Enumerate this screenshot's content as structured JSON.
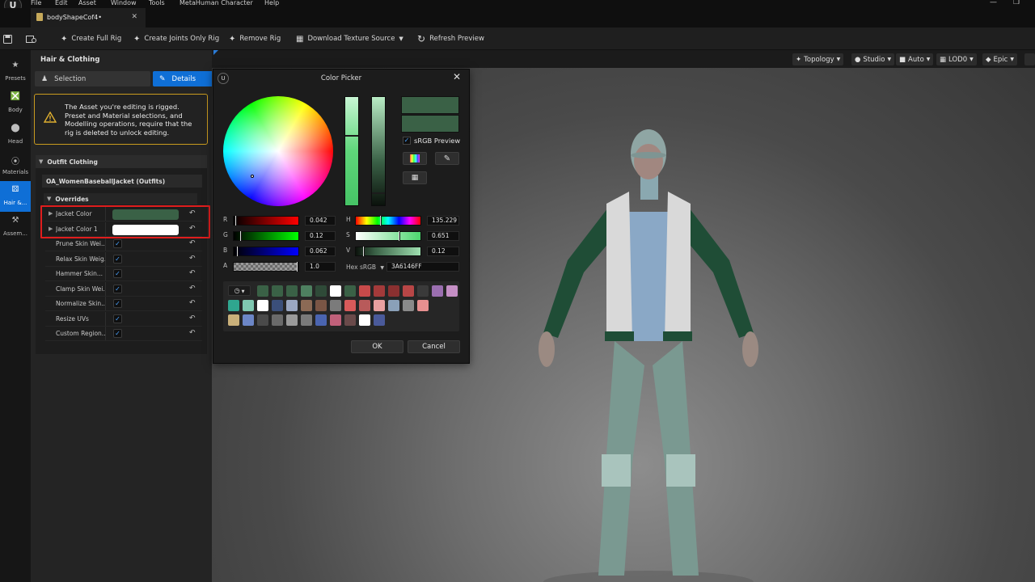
{
  "menu": [
    "File",
    "Edit",
    "Asset",
    "Window",
    "Tools",
    "MetaHuman Character",
    "Help"
  ],
  "document_tab": {
    "title": "bodyShapeCof4•"
  },
  "toolbar": {
    "create_full_rig": "Create Full Rig",
    "create_joints_only_rig": "Create Joints Only Rig",
    "remove_rig": "Remove Rig",
    "download_texture_source": "Download Texture Source",
    "refresh_preview": "Refresh Preview"
  },
  "nav": [
    {
      "label": "Presets",
      "icon": "star-icon"
    },
    {
      "label": "Body",
      "icon": "body-icon"
    },
    {
      "label": "Head",
      "icon": "head-icon"
    },
    {
      "label": "Materials",
      "icon": "materials-icon"
    },
    {
      "label": "Hair &...",
      "icon": "hair-icon",
      "active": true
    },
    {
      "label": "Assem...",
      "icon": "hammer-icon"
    }
  ],
  "panel": {
    "title": "Hair & Clothing",
    "tab_selection": "Selection",
    "tab_details": "Details",
    "warning": "The Asset you're editing is rigged. Preset and Material selections, and Modelling operations, require that the rig is deleted to unlock editing.",
    "section_outfit": "Outfit Clothing",
    "outfit_item": "OA_WomenBaseballJacket (Outfits)",
    "overrides": "Overrides",
    "color_rows": [
      {
        "label": "Jacket Color",
        "color": "#3a6146"
      },
      {
        "label": "Jacket Color 1",
        "color": "#ffffff"
      }
    ],
    "check_rows": [
      {
        "label": "Prune Skin Wei...",
        "checked": true
      },
      {
        "label": "Relax Skin Weig...",
        "checked": true
      },
      {
        "label": "Hammer Skin...",
        "checked": true
      },
      {
        "label": "Clamp Skin Wei...",
        "checked": true
      },
      {
        "label": "Normalize Skin...",
        "checked": true
      },
      {
        "label": "Resize UVs",
        "checked": true
      },
      {
        "label": "Custom Region...",
        "checked": true
      }
    ]
  },
  "viewport": {
    "topology": "Topology",
    "studio": "Studio",
    "auto": "Auto",
    "lod": "LOD0",
    "quality": "Epic"
  },
  "color_picker": {
    "title": "Color Picker",
    "srgb_preview": "sRGB Preview",
    "srgb_checked": true,
    "current_color": "#3a6146",
    "r": {
      "label": "R",
      "value": "0.042"
    },
    "g": {
      "label": "G",
      "value": "0.12"
    },
    "b": {
      "label": "B",
      "value": "0.062"
    },
    "a": {
      "label": "A",
      "value": "1.0"
    },
    "h": {
      "label": "H",
      "value": "135.229"
    },
    "s": {
      "label": "S",
      "value": "0.651"
    },
    "v": {
      "label": "V",
      "value": "0.12"
    },
    "hex_label": "Hex sRGB",
    "hex_value": "3A6146FF",
    "palette": [
      [
        "#3a6146",
        "#3a6146",
        "#3a6146",
        "#4e8060",
        "#2f4a38",
        "#ffffff",
        "#3a6146",
        "#c84a4a",
        "#a33a3a",
        "#8a3030",
        "#b84646",
        "#3a3a3a",
        "#9b6fb0",
        "#c58fc5"
      ],
      [
        "#2fa68f",
        "#7fc7b0",
        "#ffffff",
        "#3b4f7a",
        "#9aa7c2",
        "#8c6a55",
        "#7a5545",
        "#7b7b7b",
        "#d85a5a",
        "#b85a5a",
        "#e8a0a0",
        "#8aa0b8",
        "#8a8a8a",
        "#e89090"
      ],
      [
        "#c9b07a",
        "#6c86c6",
        "#4a4a4a",
        "#6a6a6a",
        "#9a9a9a",
        "#7a7a7a",
        "#4a64b0",
        "#c0607a",
        "#6a4a4a",
        "#ffffff",
        "#4a5a9a"
      ]
    ],
    "ok": "OK",
    "cancel": "Cancel"
  }
}
